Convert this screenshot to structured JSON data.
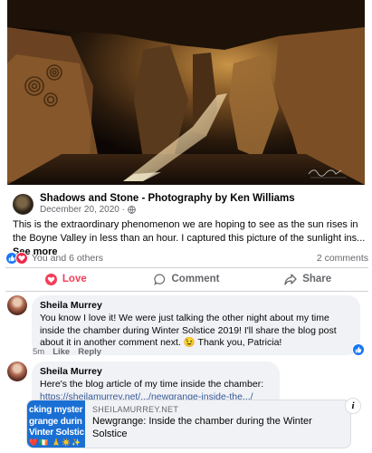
{
  "post": {
    "page_name": "Shadows and Stone - Photography by Ken Williams",
    "date": "December 20, 2020 ·",
    "text": "This is the extraordinary phenomenon we are hoping to see as the sun rises in the Boyne Valley in less than an hour. I captured this picture of the sunlight ins...",
    "see_more": "See more"
  },
  "reactions": {
    "summary": "You and 6 others",
    "comments_count": "2 comments",
    "icons": [
      "like-icon",
      "love-icon"
    ]
  },
  "actions": {
    "love": "Love",
    "comment": "Comment",
    "share": "Share"
  },
  "comments": [
    {
      "author": "Sheila Murrey",
      "text": "You know I love it! We were just talking the other night about my time inside the chamber during Winter Solstice 2019! I'll share the blog post about it in another comment next. 😉 Thank you, Patricia!",
      "time": "5m",
      "like": "Like",
      "reply": "Reply"
    },
    {
      "author": "Sheila Murrey",
      "text": "Here's the blog article of my time inside the chamber:",
      "link": "https://sheilamurrey.net/.../newgrange-inside-the.../"
    }
  ],
  "link_preview": {
    "domain": "SHEILAMURREY.NET",
    "title": "Newgrange: Inside the chamber during the Winter Solstice",
    "thumb_lines": [
      "cking myster",
      "grange durin",
      "Vinter Solstic"
    ],
    "thumb_emojis": "❤️🇮🇪 🙏☀️✨"
  },
  "colors": {
    "accent_blue": "#1877f2",
    "love_red": "#f33e58",
    "link": "#385898"
  }
}
